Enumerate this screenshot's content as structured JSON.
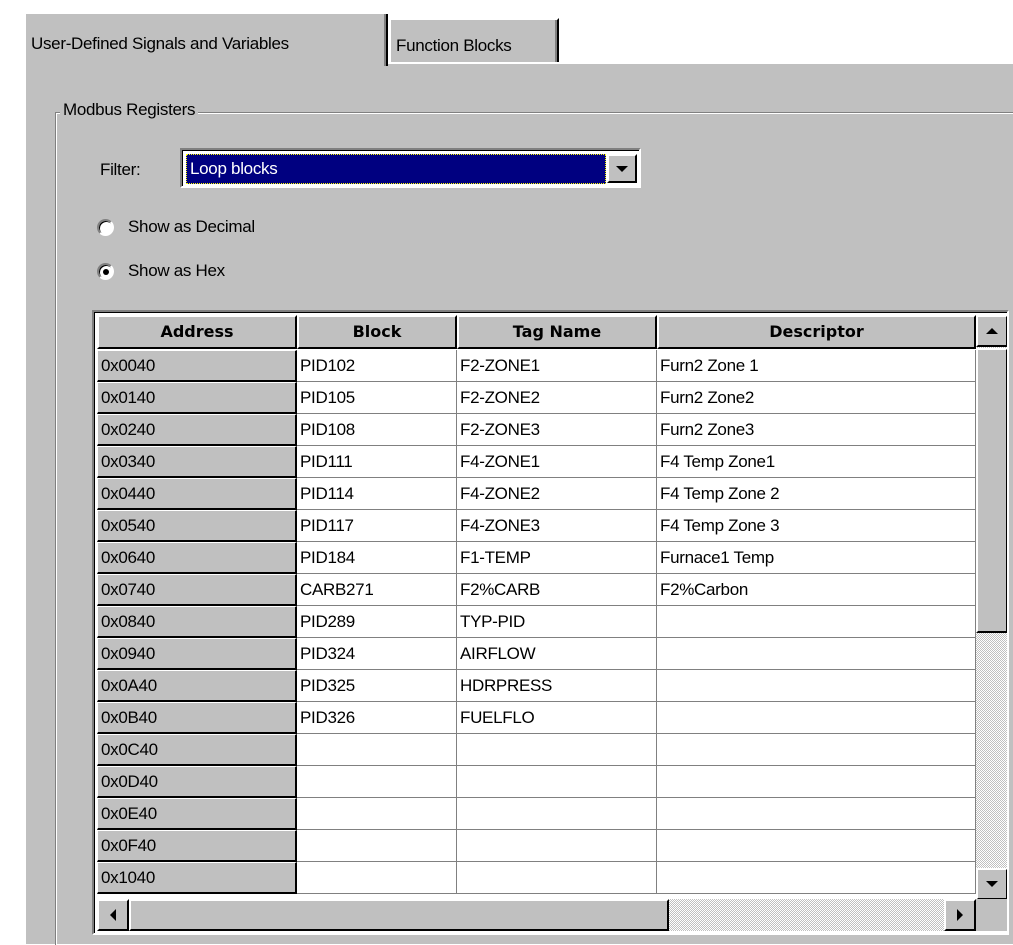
{
  "tabs": {
    "user_defined": "User-Defined Signals and Variables",
    "function_blocks": "Function Blocks"
  },
  "group": {
    "label": "Modbus Registers"
  },
  "filter": {
    "label": "Filter:",
    "value": "Loop blocks"
  },
  "radios": {
    "decimal": {
      "label": "Show as Decimal",
      "checked": false
    },
    "hex": {
      "label": "Show as Hex",
      "checked": true
    }
  },
  "grid": {
    "columns": [
      "Address",
      "Block",
      "Tag Name",
      "Descriptor"
    ],
    "rows": [
      [
        "0x0040",
        "PID102",
        "F2-ZONE1",
        "Furn2 Zone 1"
      ],
      [
        "0x0140",
        "PID105",
        "F2-ZONE2",
        "Furn2 Zone2"
      ],
      [
        "0x0240",
        "PID108",
        "F2-ZONE3",
        "Furn2 Zone3"
      ],
      [
        "0x0340",
        "PID111",
        "F4-ZONE1",
        "F4 Temp Zone1"
      ],
      [
        "0x0440",
        "PID114",
        "F4-ZONE2",
        "F4 Temp Zone 2"
      ],
      [
        "0x0540",
        "PID117",
        "F4-ZONE3",
        "F4 Temp Zone 3"
      ],
      [
        "0x0640",
        "PID184",
        "F1-TEMP",
        "Furnace1 Temp"
      ],
      [
        "0x0740",
        "CARB271",
        "F2%CARB",
        "F2%Carbon"
      ],
      [
        "0x0840",
        "PID289",
        "TYP-PID",
        ""
      ],
      [
        "0x0940",
        "PID324",
        "AIRFLOW",
        ""
      ],
      [
        "0x0A40",
        "PID325",
        "HDRPRESS",
        ""
      ],
      [
        "0x0B40",
        "PID326",
        "FUELFLO",
        ""
      ],
      [
        "0x0C40",
        "",
        "",
        ""
      ],
      [
        "0x0D40",
        "",
        "",
        ""
      ],
      [
        "0x0E40",
        "",
        "",
        ""
      ],
      [
        "0x0F40",
        "",
        "",
        ""
      ],
      [
        "0x1040",
        "",
        "",
        ""
      ]
    ]
  },
  "icons": {
    "dropdown": "chevron-down-icon",
    "scroll_up": "scroll-up-arrow-icon",
    "scroll_down": "scroll-down-arrow-icon",
    "scroll_left": "scroll-left-arrow-icon",
    "scroll_right": "scroll-right-arrow-icon"
  }
}
